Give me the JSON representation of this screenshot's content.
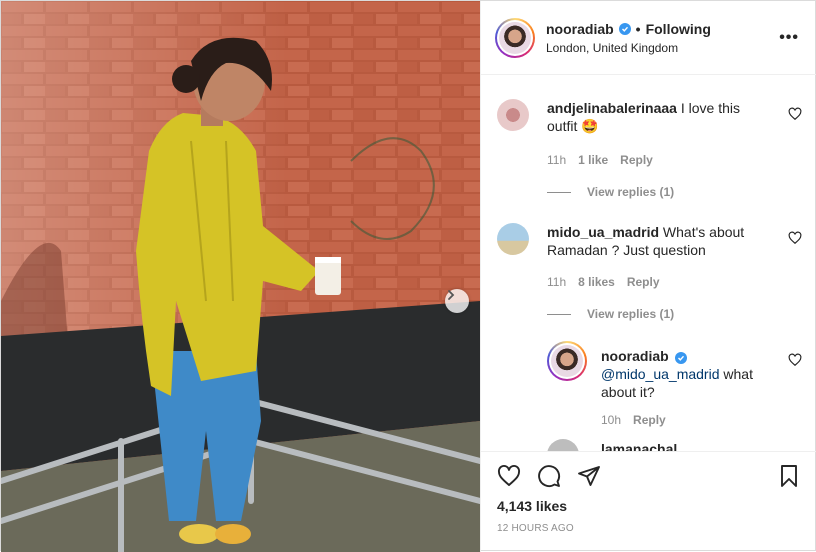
{
  "post": {
    "username": "nooradiab",
    "separator": "•",
    "follow_status": "Following",
    "location": "London, United Kingdom",
    "more_options": "•••",
    "likes": "4,143 likes",
    "time_ago": "12 HOURS AGO"
  },
  "comments": [
    {
      "username": "andjelinabalerinaaa",
      "text": "I love this outfit 🤩",
      "time": "11h",
      "likes": "1 like",
      "reply": "Reply",
      "view_replies": "View replies (1)"
    },
    {
      "username": "mido_ua_madrid",
      "text": "What's about Ramadan ? Just question",
      "time": "11h",
      "likes": "8 likes",
      "reply": "Reply",
      "view_replies": "View replies (1)",
      "reply_item": {
        "username": "nooradiab",
        "mention": "@mido_ua_madrid",
        "text": "what about it?",
        "time": "10h",
        "reply": "Reply"
      }
    }
  ],
  "partial_next_comment": "lamanachal",
  "icons": {
    "like": "heart-icon",
    "comment": "comment-icon",
    "share": "paper-plane-icon",
    "save": "bookmark-icon",
    "next": "chevron-right-icon",
    "verified": "verified-badge-icon"
  },
  "colors": {
    "verified_blue": "#3897f0",
    "muted_text": "#8e8e8e",
    "link": "#00376b"
  }
}
